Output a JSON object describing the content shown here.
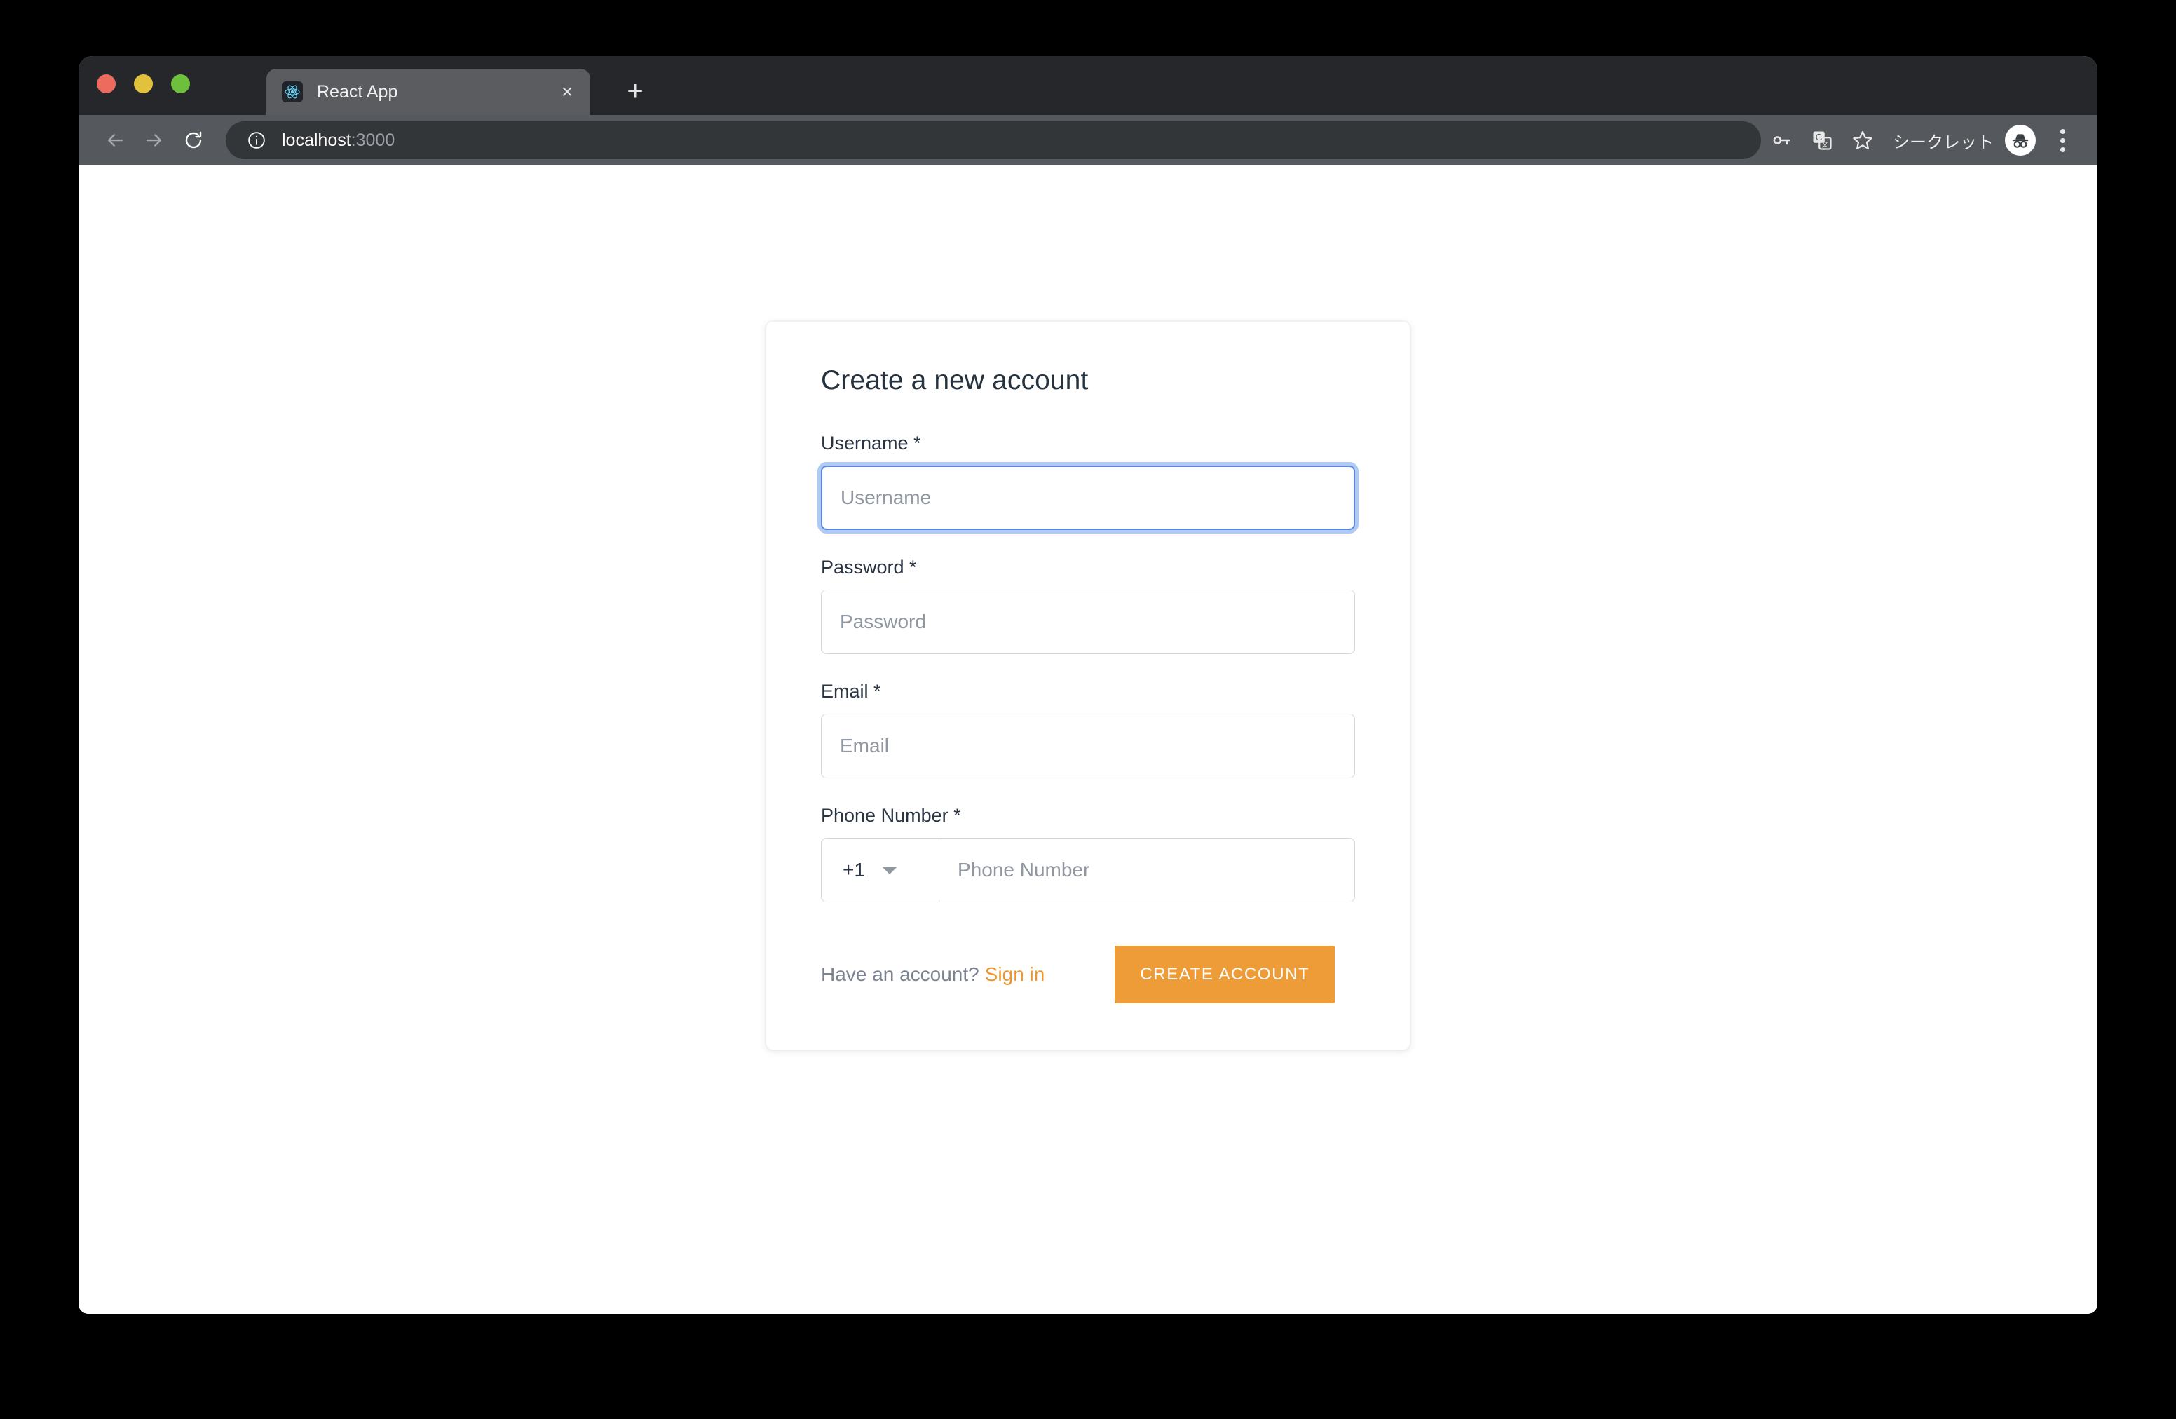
{
  "browser": {
    "window_controls": [
      {
        "name": "close",
        "color": "#ec6a5e"
      },
      {
        "name": "minimize",
        "color": "#e2c23c"
      },
      {
        "name": "maximize",
        "color": "#6fbf3e"
      }
    ],
    "tab": {
      "title": "React App",
      "favicon": "react-logo-icon",
      "close_label": "×"
    },
    "new_tab_label": "+",
    "nav": {
      "back": "back-arrow-icon",
      "forward": "forward-arrow-icon",
      "reload": "reload-icon"
    },
    "omnibox": {
      "security_icon": "info-circle-icon",
      "url_host": "localhost",
      "url_port": ":3000",
      "full_url": "localhost:3000"
    },
    "toolbar_icons": [
      {
        "name": "key-icon"
      },
      {
        "name": "translate-icon"
      },
      {
        "name": "bookmark-star-icon"
      }
    ],
    "profile": {
      "label": "シークレット",
      "avatar_icon": "incognito-icon"
    },
    "menu_icon": "three-dot-menu-icon"
  },
  "page": {
    "card": {
      "title": "Create a new account",
      "fields": [
        {
          "id": "username",
          "label": "Username *",
          "placeholder": "Username",
          "value": "",
          "focused": true
        },
        {
          "id": "password",
          "label": "Password *",
          "placeholder": "Password",
          "value": "",
          "focused": false
        },
        {
          "id": "email",
          "label": "Email *",
          "placeholder": "Email",
          "value": "",
          "focused": false
        }
      ],
      "phone": {
        "label": "Phone Number *",
        "country_code": "+1",
        "placeholder": "Phone Number",
        "value": "",
        "caret_icon": "chevron-down-icon"
      },
      "footer": {
        "have_account_text": "Have an account?",
        "signin_label": "Sign in",
        "submit_label": "CREATE ACCOUNT"
      }
    }
  },
  "colors": {
    "accent_orange": "#ee9c38",
    "link_orange": "#f0962c",
    "focus_blue": "#5b87e0",
    "heading": "#26323d",
    "placeholder": "#9097a0",
    "page_background": "#ffffff",
    "tabstrip_background": "#25272b",
    "toolbar_background": "#55585c",
    "omnibox_background": "#333639",
    "desktop_background": "#000000"
  }
}
